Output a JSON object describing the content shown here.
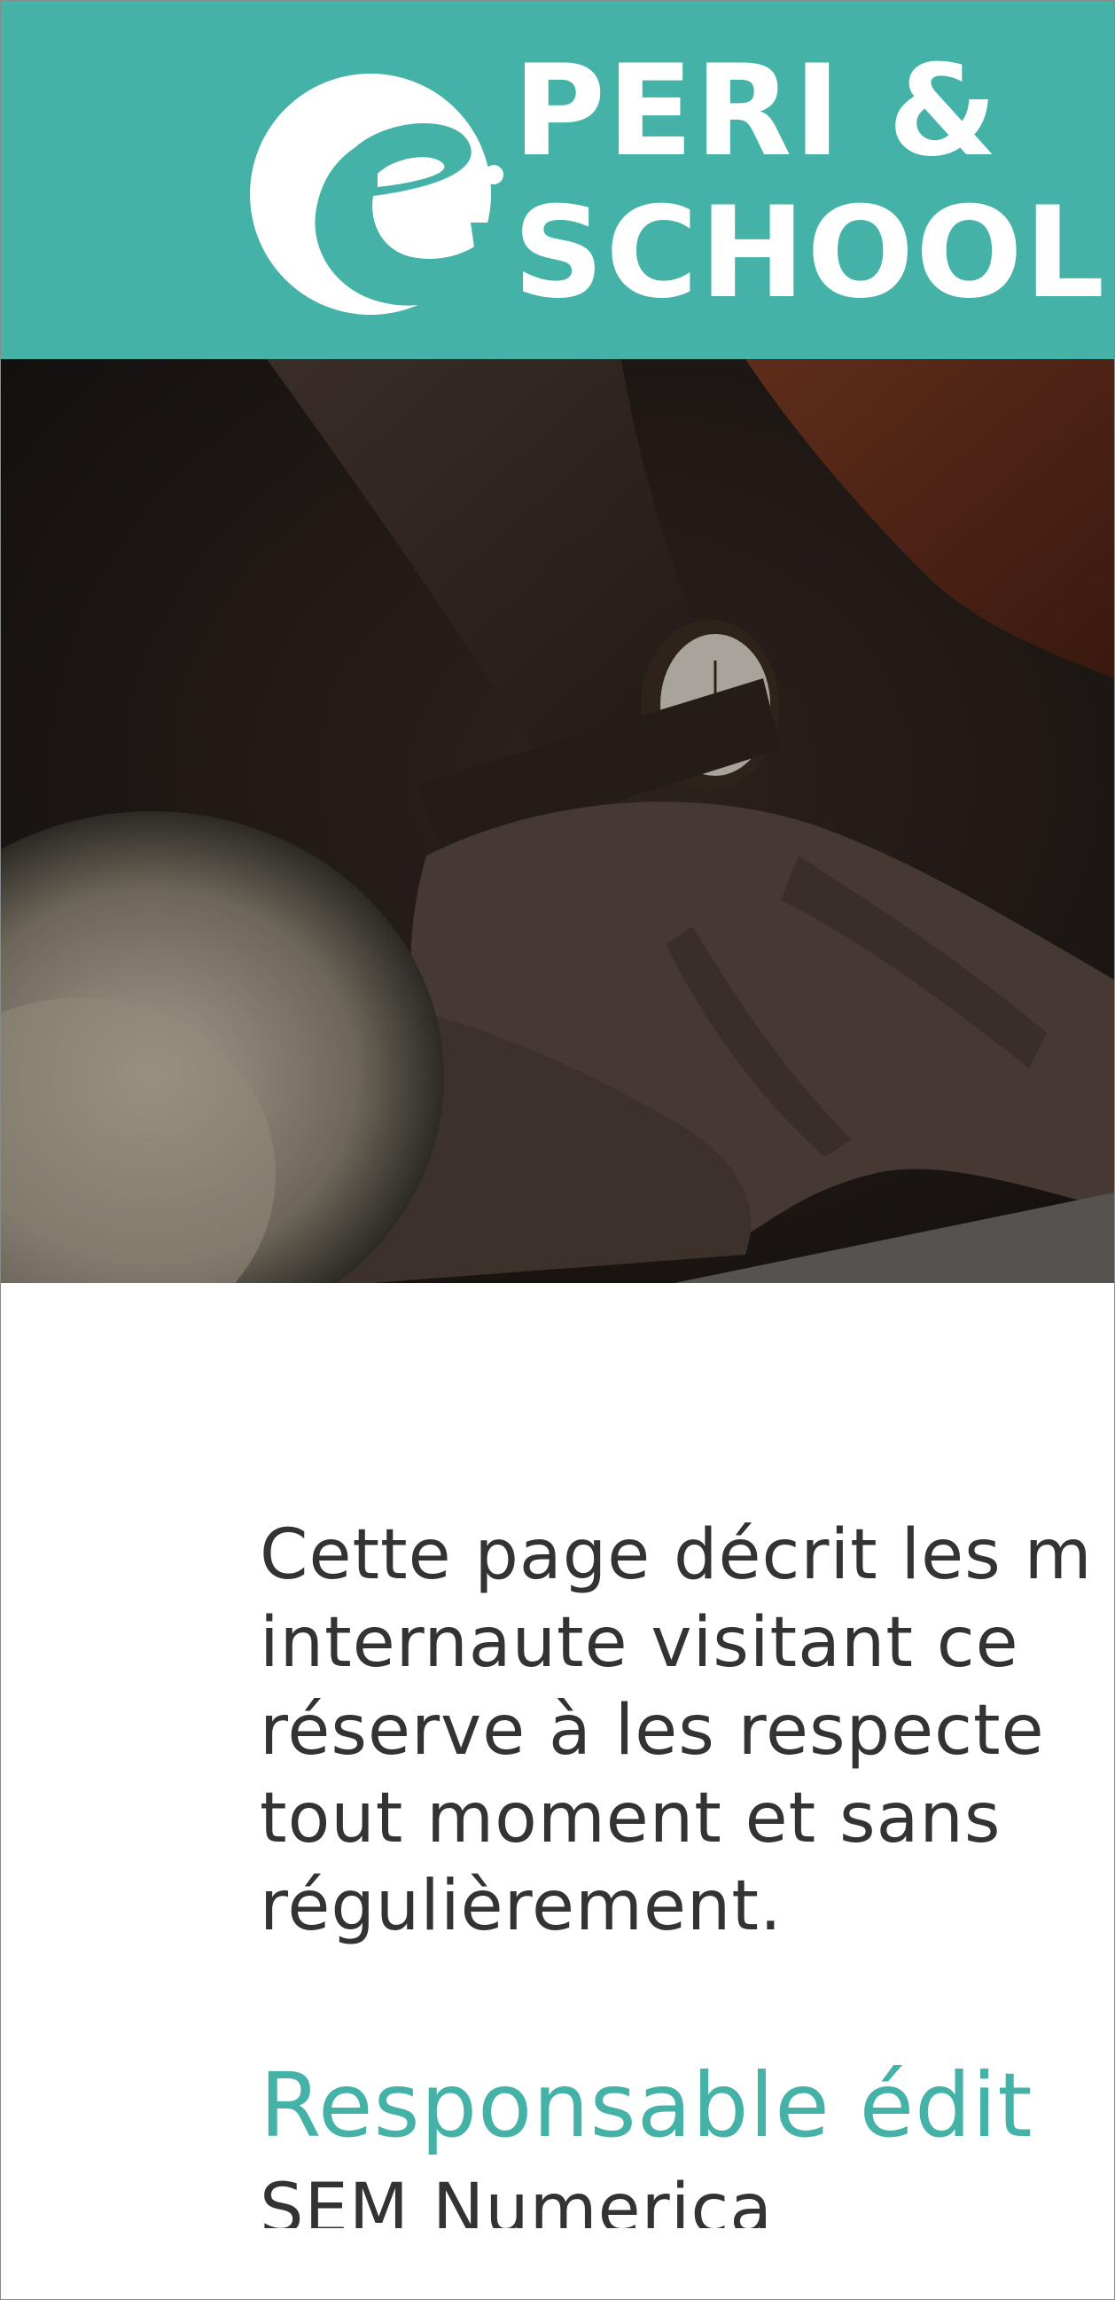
{
  "brand": {
    "logo_letter": "e",
    "logo_line1": "PERI &",
    "logo_line2": "SCHOOL",
    "color": "#44b2a6"
  },
  "hero": {
    "image": "photo-hands-typing-with-wristwatch"
  },
  "content": {
    "intro_lines": [
      "Cette page décrit les m",
      "internaute visitant ce",
      "réserve à les respecte",
      "tout moment et sans",
      "régulièrement."
    ],
    "section_title": "Responsable édit",
    "section_body": "SEM Numerica"
  },
  "colors": {
    "accent": "#44b2a6",
    "text": "#333333",
    "background": "#ffffff"
  }
}
